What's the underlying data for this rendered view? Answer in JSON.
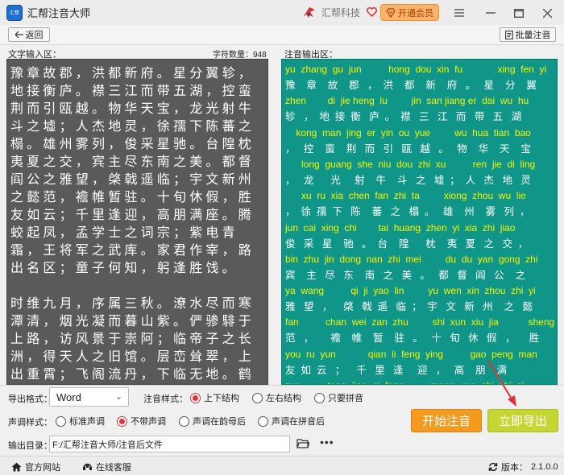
{
  "app": {
    "title": "汇帮注音大师",
    "logo_text": "汇帮"
  },
  "brand": {
    "name": "汇帮科技"
  },
  "vip_button": "开通会员",
  "toolbar": {
    "back": "返回",
    "batch": "批量注音"
  },
  "input": {
    "label": "文字输入区：",
    "char_count_label": "字符数量：",
    "char_count": "948",
    "paragraphs": [
      "豫章故郡，洪都新府。星分翼轸，地接衡庐。襟三江而带五湖，控蛮荆而引瓯越。物华天宝，龙光射牛斗之墟；人杰地灵，徐孺下陈蕃之榻。雄州雾列，俊采星驰。台隍枕夷夏之交，宾主尽东南之美。都督阎公之雅望，棨戟遥临；宇文新州之懿范，襜帷暂驻。十旬休假，胜友如云；千里逢迎，高朋满座。腾蛟起凤，孟学士之词宗；紫电青霜，王将军之武库。家君作宰，路出名区；童子何知，躬逢胜饯。",
      "时维九月，序属三秋。潦水尽而寒潭清，烟光凝而暮山紫。俨骖騑于上路，访风景于崇阿；临帝子之长洲，得天人之旧馆。层峦耸翠，上出重霄；飞阁流丹，下临无地。鹤汀凫渚，穷岛屿之萦回；桂殿兰宫，即冈峦之体势。"
    ]
  },
  "output": {
    "label": "注音输出区：",
    "lines": [
      {
        "py": "yu  zhang  gu  jun          hong  dou  xin  fu             xing  fen  yi",
        "hz": "豫    章    故    郡   ，  洪    都    新    府   。   星    分    翼"
      },
      {
        "py": "zhen        di  jie heng  lu         jin  san jiang er  dai  wu  hu",
        "hz": "轸   ，  地  接  衡   庐  。  襟   三   江   而   带   五   湖"
      },
      {
        "py": "    kong  man  jing  er  yin  ou  yue         wu  hua  tian  bao",
        "hz": "，   控    蛮    荆   而   引   瓯   越   。   物    华    天    宝"
      },
      {
        "py": "      long  guang  she  niu  dou  zhi  xu          ren  jie  di  ling",
        "hz": "，   龙      光     射    牛    斗   之   墟  ；  人   杰   地   灵"
      },
      {
        "py": "      xu  ru  xia  chen  fan  zhi  ta         xiong  zhou  wu  lie",
        "hz": "，  徐  孺  下   陈    蕃   之   榻  。   雄    州    雾   列  ，"
      },
      {
        "py": "jun  cai  xing  chi        tai  huang  zhen  yi  xia  zhi  jiao",
        "hz": "俊   采   星    驰   。  台    隍      枕    夷   夏   之   交  ，"
      },
      {
        "py": "bin  zhu  jin  dong  nan  zhi  mei         du  du  yan  gong  zhi",
        "hz": "宾    主   尽   东    南   之   美   。   都   督   阎   公    之"
      },
      {
        "py": "ya  wang          qi  ji  yao  lin         yu  wen  xin  zhou  zhi  yi",
        "hz": "雅   望   ，    棨   戟  遥   临  ；  宇   文   新   州    之   懿"
      },
      {
        "py": "fan          chan  wei  zan  zhu         shi  xun  xiu  jia           sheng",
        "hz": "范   ，      襜    帷    暂    驻   。   十   旬   休   假   ，     胜"
      },
      {
        "py": "you  ru  yun            qian  li  feng  ying          gao  peng  man",
        "hz": "友  如  云   ；    千   里   逢     迎   ，   高    朋    满"
      },
      {
        "py": "zuo          teng  jiao  qi  feng          meng  xue  shi  zhi  ci",
        "hz": ""
      }
    ]
  },
  "options": {
    "format_label": "导出格式：",
    "format_value": "Word",
    "style_label": "注音样式：",
    "style_options": [
      "上下结构",
      "左右结构",
      "只要拼音"
    ],
    "tone_label": "声调样式：",
    "tone_options": [
      "标准声调",
      "不带声调",
      "声调在韵母后",
      "声调在拼音后"
    ],
    "dir_label": "输出目录：",
    "dir_value": "F:/汇帮注音大师/注音后文件"
  },
  "buttons": {
    "start": "开始注音",
    "export": "立即导出"
  },
  "footer": {
    "website": "官方网站",
    "service": "在线客服",
    "version_label": "版本：",
    "version": "2.1.0.0"
  },
  "colors": {
    "accent_red": "#e0313b",
    "output_bg": "#0f9688",
    "pinyin": "#f8f400",
    "start": "#f39a1f",
    "export": "#c3d632"
  }
}
